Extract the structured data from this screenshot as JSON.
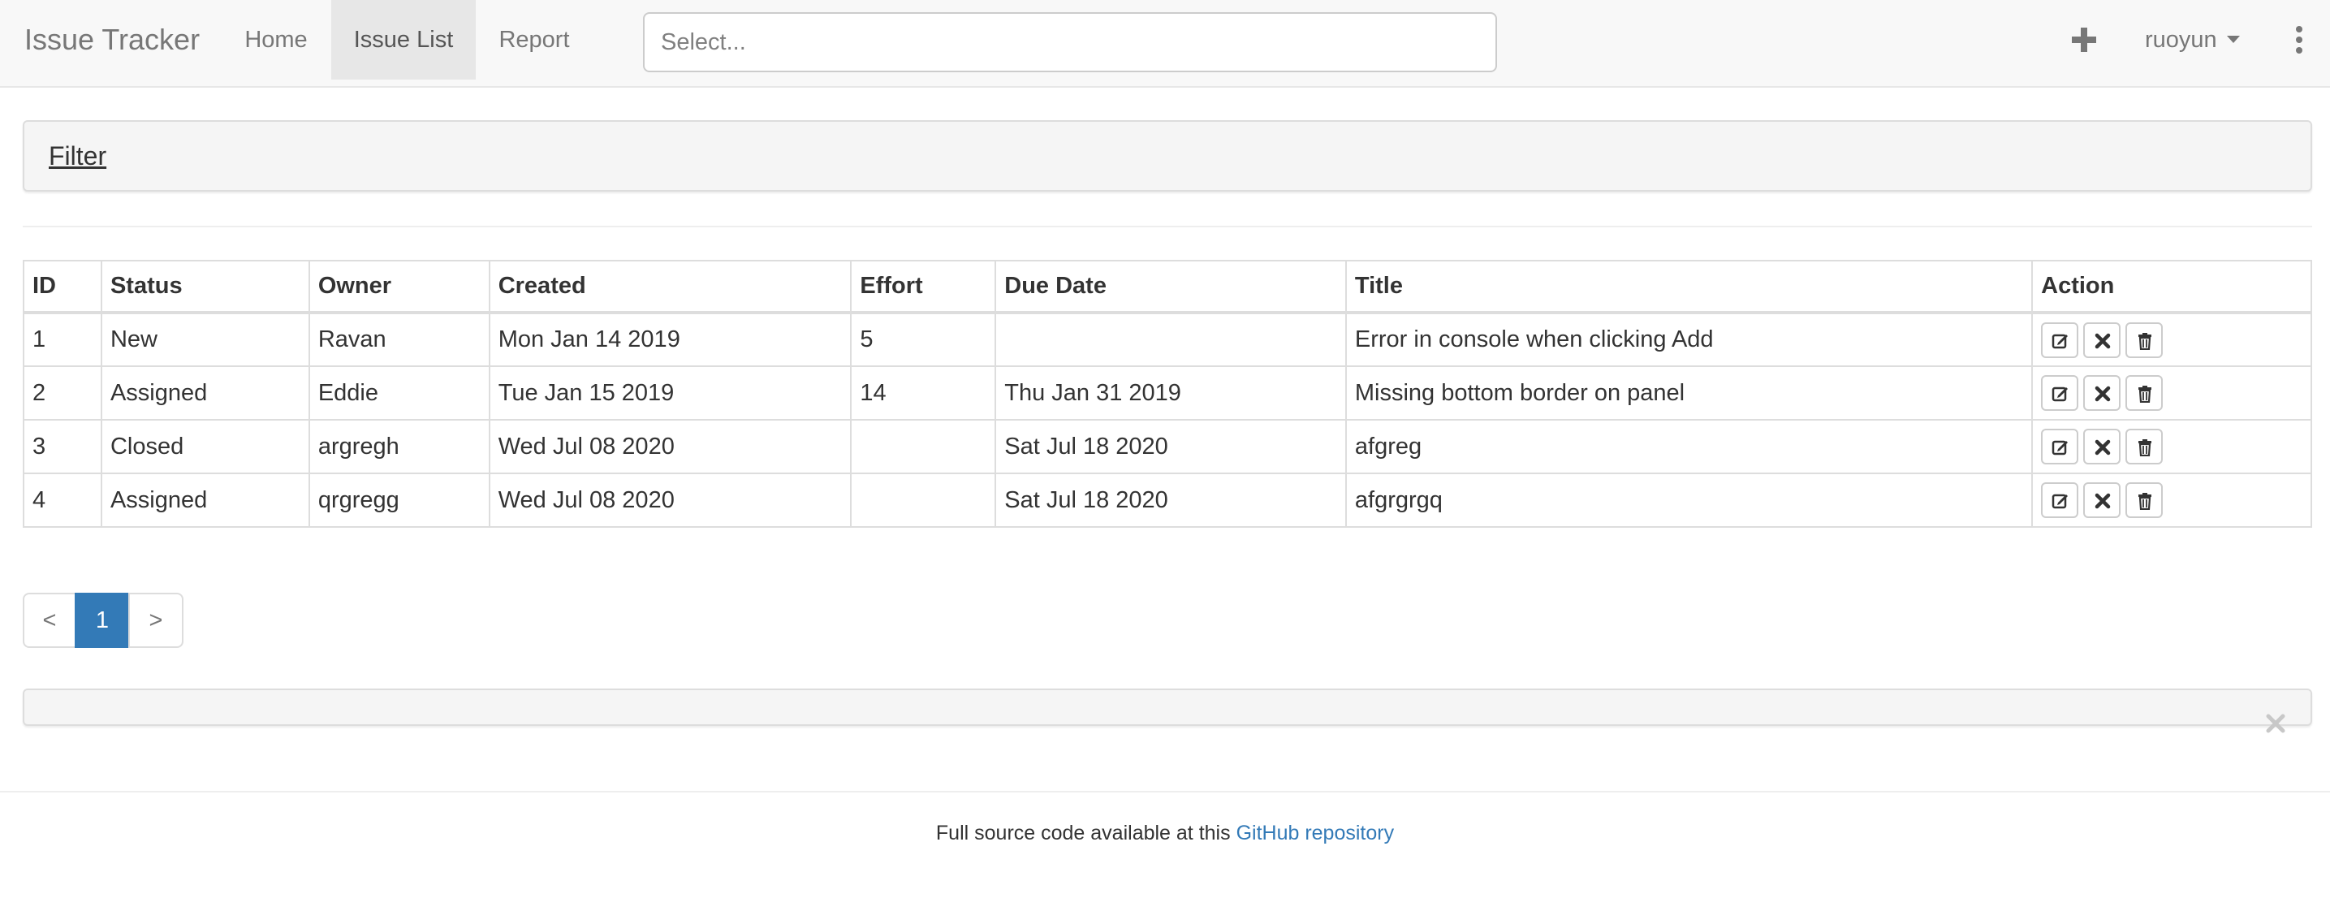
{
  "navbar": {
    "brand": "Issue Tracker",
    "items": [
      {
        "label": "Home",
        "active": false
      },
      {
        "label": "Issue List",
        "active": true
      },
      {
        "label": "Report",
        "active": false
      }
    ],
    "search_placeholder": "Select...",
    "add_icon": "plus-icon",
    "user": "ruoyun",
    "menu_icon": "vertical-ellipsis-icon"
  },
  "filter": {
    "title": "Filter"
  },
  "table": {
    "headers": [
      "ID",
      "Status",
      "Owner",
      "Created",
      "Effort",
      "Due Date",
      "Title",
      "Action"
    ],
    "rows": [
      {
        "id": "1",
        "status": "New",
        "owner": "Ravan",
        "created": "Mon Jan 14 2019",
        "effort": "5",
        "due": "",
        "title": "Error in console when clicking Add"
      },
      {
        "id": "2",
        "status": "Assigned",
        "owner": "Eddie",
        "created": "Tue Jan 15 2019",
        "effort": "14",
        "due": "Thu Jan 31 2019",
        "title": "Missing bottom border on panel"
      },
      {
        "id": "3",
        "status": "Closed",
        "owner": "argregh",
        "created": "Wed Jul 08 2020",
        "effort": "",
        "due": "Sat Jul 18 2020",
        "title": "afgreg"
      },
      {
        "id": "4",
        "status": "Assigned",
        "owner": "qrgregg",
        "created": "Wed Jul 08 2020",
        "effort": "",
        "due": "Sat Jul 18 2020",
        "title": "afgrgrgq"
      }
    ],
    "action_icons": [
      "edit-icon",
      "close-icon",
      "trash-icon"
    ]
  },
  "pagination": {
    "prev": "<",
    "current": "1",
    "next": ">"
  },
  "footer": {
    "text": "Full source code available at this ",
    "link": "GitHub repository"
  },
  "colors": {
    "accent": "#337ab7",
    "navbar_bg": "#f8f8f8",
    "panel_bg": "#f5f5f5"
  }
}
